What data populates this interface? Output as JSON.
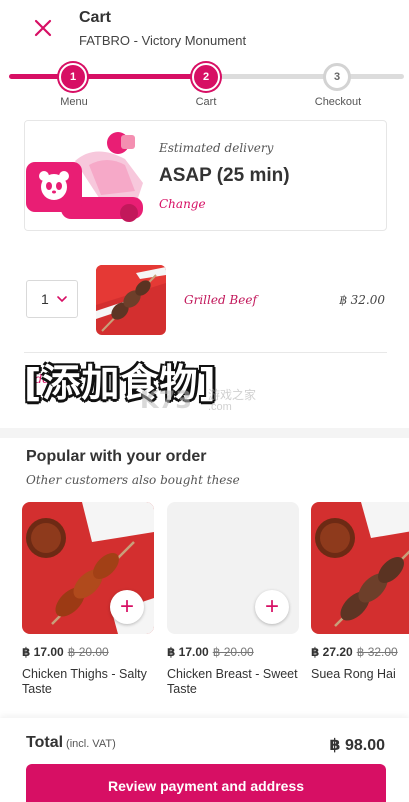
{
  "header": {
    "title": "Cart",
    "restaurant": "FATBRO - Victory Monument"
  },
  "progress": {
    "steps": [
      {
        "number": "1",
        "label": "Menu",
        "state": "done"
      },
      {
        "number": "2",
        "label": "Cart",
        "state": "current"
      },
      {
        "number": "3",
        "label": "Checkout",
        "state": "todo"
      }
    ]
  },
  "delivery": {
    "label": "Estimated delivery",
    "time": "ASAP (25 min)",
    "change_label": "Change"
  },
  "cart_items": [
    {
      "quantity": "1",
      "name": "Grilled Beef",
      "price": "฿ 32.00"
    }
  ],
  "add_items_label": "Add",
  "overlay": {
    "text": "[添加食物]",
    "watermark_logo": "K73",
    "watermark_name": "游戏之家",
    "watermark_url": ".com"
  },
  "popular": {
    "title": "Popular with your order",
    "subtitle": "Other customers also bought these",
    "items": [
      {
        "price": "฿ 17.00",
        "old_price": "฿ 20.00",
        "name": "Chicken Thighs - Salty Taste"
      },
      {
        "price": "฿ 17.00",
        "old_price": "฿ 20.00",
        "name": "Chicken Breast - Sweet Taste"
      },
      {
        "price": "฿ 27.20",
        "old_price": "฿ 32.00",
        "name": "Suea Rong Hai"
      }
    ]
  },
  "footer": {
    "total_label": "Total",
    "vat_label": "(incl. VAT)",
    "total_value": "฿ 98.00",
    "button_label": "Review payment and address"
  },
  "colors": {
    "brand": "#d70f64",
    "inactive": "#dcdcdc"
  }
}
